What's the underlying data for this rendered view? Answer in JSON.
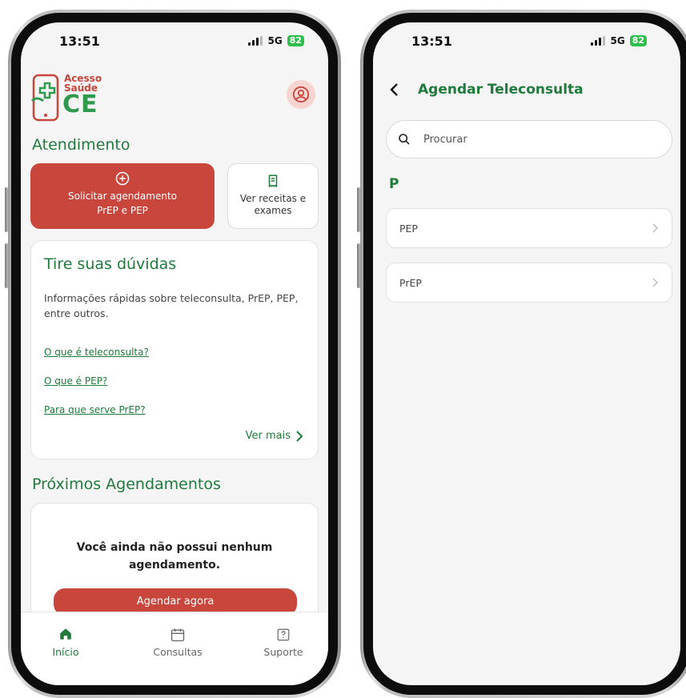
{
  "colors": {
    "primary_green": "#1f7a3c",
    "accent_red": "#c8463c",
    "background": "#f5f5f5"
  },
  "status_bar": {
    "time": "13:51",
    "network": "5G",
    "battery": "82"
  },
  "home": {
    "logo": {
      "line1": "Acesso",
      "line2": "Saúde",
      "line3": "CE"
    },
    "attendance_title": "Atendimento",
    "request_card": {
      "line1": "Solicitar agendamento",
      "line2": "PrEP e PEP"
    },
    "prescriptions_card": {
      "line1": "Ver receitas e",
      "line2": "exames"
    },
    "faq": {
      "title": "Tire suas dúvidas",
      "description": "Informações rápidas sobre teleconsulta, PrEP, PEP, entre outros.",
      "links": [
        "O que é teleconsulta?",
        "O que é PEP?",
        "Para que serve PrEP?"
      ],
      "see_more": "Ver mais"
    },
    "upcoming_title": "Próximos Agendamentos",
    "empty_message": "Você ainda não possui nenhum agendamento.",
    "schedule_button": "Agendar agora",
    "tabs": [
      {
        "label": "Início",
        "icon": "home-icon",
        "active": true
      },
      {
        "label": "Consultas",
        "icon": "calendar-icon",
        "active": false
      },
      {
        "label": "Suporte",
        "icon": "help-icon",
        "active": false
      }
    ]
  },
  "schedule": {
    "title": "Agendar Teleconsulta",
    "search": {
      "placeholder": "Procurar",
      "value": ""
    },
    "group_letter": "P",
    "items": [
      "PEP",
      "PrEP"
    ]
  }
}
